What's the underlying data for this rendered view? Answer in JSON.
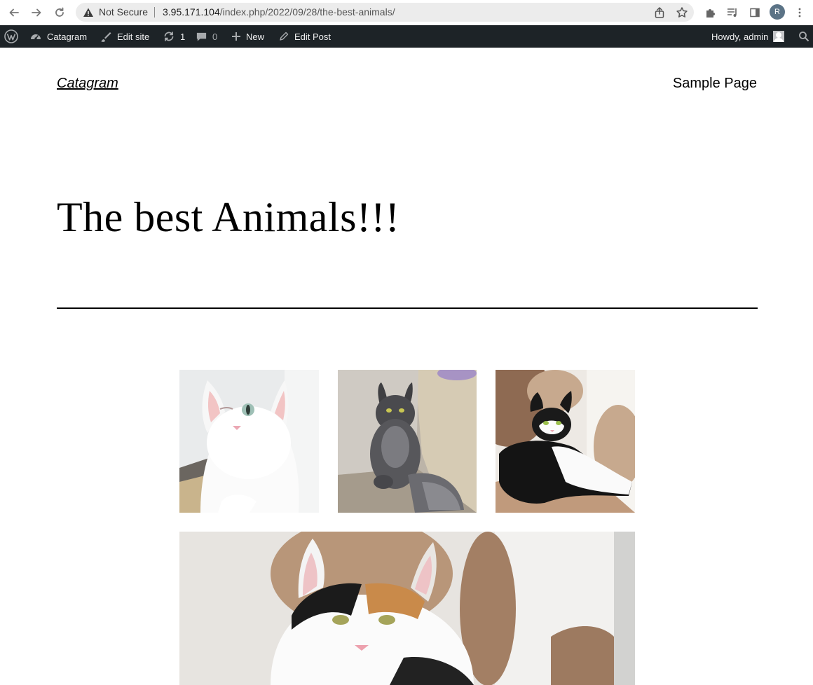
{
  "browser": {
    "security_label": "Not Secure",
    "url_host": "3.95.171.104",
    "url_path": "/index.php/2022/09/28/the-best-animals/",
    "profile_initial": "R"
  },
  "adminbar": {
    "site_name": "Catagram",
    "edit_site": "Edit site",
    "updates_count": "1",
    "comments_count": "0",
    "new_label": "New",
    "edit_post": "Edit Post",
    "howdy": "Howdy, admin"
  },
  "site": {
    "title": "Catagram",
    "nav": [
      "Sample Page"
    ]
  },
  "post": {
    "title": "The best Animals!!!"
  },
  "gallery": {
    "images": [
      {
        "subject": "white-cat"
      },
      {
        "subject": "gray-longhair-cat"
      },
      {
        "subject": "tuxedo-cat"
      },
      {
        "subject": "calico-cat"
      }
    ]
  },
  "colors": {
    "adminbar_bg": "#1d2327",
    "adminbar_text": "#f0f0f1",
    "text": "#000000",
    "background": "#ffffff"
  }
}
